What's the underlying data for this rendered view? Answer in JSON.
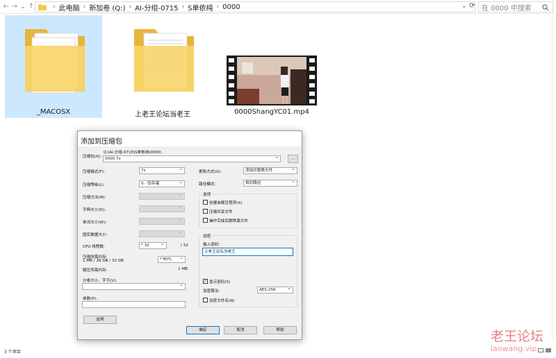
{
  "nav": {
    "back": "←",
    "forward": "→",
    "down": "⌄",
    "up": "↑"
  },
  "breadcrumb": [
    "此电脑",
    "新加卷 (Q:)",
    "AI-分组-0715",
    "S单依纯",
    "0000"
  ],
  "address_separator": "›",
  "address_dropdown": "⌄",
  "refresh_icon": "⟳",
  "search": {
    "placeholder": "在 0000 中搜索"
  },
  "files": [
    {
      "name": "_MACOSX",
      "type": "folder",
      "selected": true
    },
    {
      "name": "上老王论坛当老王",
      "type": "folder",
      "selected": false
    },
    {
      "name": "0000ShangYC01.mp4",
      "type": "video",
      "selected": false
    }
  ],
  "status_bar": "3 个项目",
  "watermark": {
    "line1": "老王论坛",
    "line2": "laowang.vip"
  },
  "dialog": {
    "title": "添加到压缩包",
    "archive_label": "压缩包(A):",
    "archive_path": "Q:\\AI-分组-0715\\S单依纯\\0000\\",
    "archive_name": "0000.7z",
    "browse_label": "...",
    "left": [
      {
        "label": "压缩格式(F):",
        "value": "7z",
        "disabled": false
      },
      {
        "label": "压缩等级(L):",
        "value": "0 - 仅存储",
        "disabled": false
      },
      {
        "label": "压缩方法(M):",
        "value": "",
        "disabled": true
      },
      {
        "label": "字典大小(D):",
        "value": "",
        "disabled": true
      },
      {
        "label": "单词大小(W):",
        "value": "",
        "disabled": true
      },
      {
        "label": "固实数据大小:",
        "value": "",
        "disabled": true
      }
    ],
    "cpu_label": "CPU 线程数:",
    "cpu_value": "* 32",
    "cpu_total": "/ 32",
    "mem_label": "压缩所需内存:",
    "mem_detail": "1 MB / 26 GB / 32 GB",
    "mem_value": "* 80%",
    "decomp_label": "解压所需内存:",
    "decomp_value": "1 MB",
    "split_label": "分卷大小，字节(V):",
    "params_label": "参数(P):",
    "options_button": "选项",
    "update_label": "更新方式(U):",
    "update_value": "添加并替换文件",
    "path_label": "路径模式:",
    "path_value": "相对路径",
    "options_group": "选项",
    "option_items": [
      {
        "label": "创建自解压程序(X)",
        "checked": false
      },
      {
        "label": "压缩共享文件",
        "checked": false
      },
      {
        "label": "操作完成后删除源文件",
        "checked": false
      }
    ],
    "encrypt_group": "加密",
    "password_label": "输入密码:",
    "password_value": "上老王论坛当老王",
    "show_password": {
      "label": "显示密码(S)",
      "checked": true
    },
    "method_label": "加密算法:",
    "method_value": "AES-256",
    "encrypt_names": {
      "label": "加密文件名(N)",
      "checked": false
    },
    "ok": "确定",
    "cancel": "取消",
    "help": "帮助"
  }
}
